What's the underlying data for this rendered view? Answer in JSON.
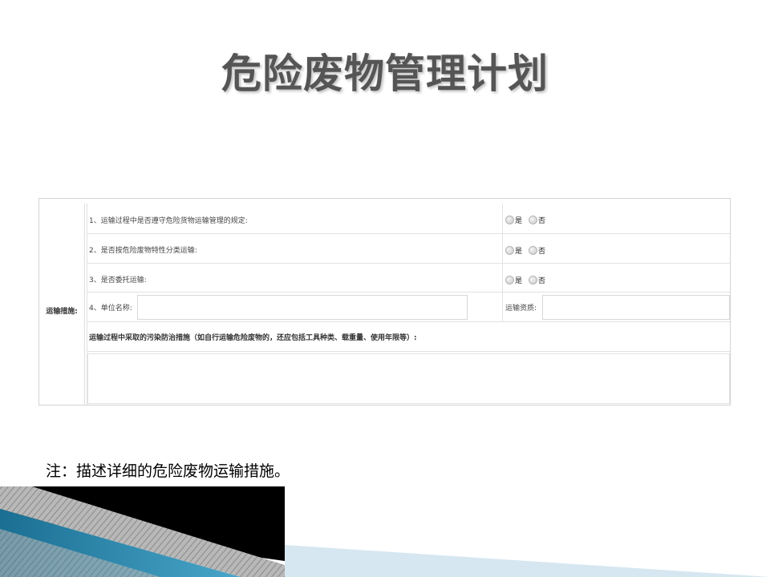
{
  "slide": {
    "title": "危险废物管理计划",
    "note": "注：描述详细的危险废物运输措施。"
  },
  "form": {
    "section_label": "运输措施:",
    "questions": [
      {
        "label": "1、运输过程中是否遵守危险货物运输管理的规定:",
        "options": [
          "是",
          "否"
        ]
      },
      {
        "label": "2、是否按危险废物特性分类运输:",
        "options": [
          "是",
          "否"
        ]
      },
      {
        "label": "3、是否委托运输:",
        "options": [
          "是",
          "否"
        ]
      }
    ],
    "unit_name_label": "4、单位名称:",
    "unit_name_value": "",
    "qualification_label": "运输资质:",
    "qualification_value": "",
    "measures_label": "运输过程中采取的污染防治措施（如自行运输危险废物的，还应包括工具种类、载重量、使用年限等）:",
    "measures_value": ""
  },
  "colors": {
    "title": "#555555",
    "decor_black": "#000000",
    "decor_teal": "#1f7fa3",
    "decor_light": "#cfe3ef"
  }
}
